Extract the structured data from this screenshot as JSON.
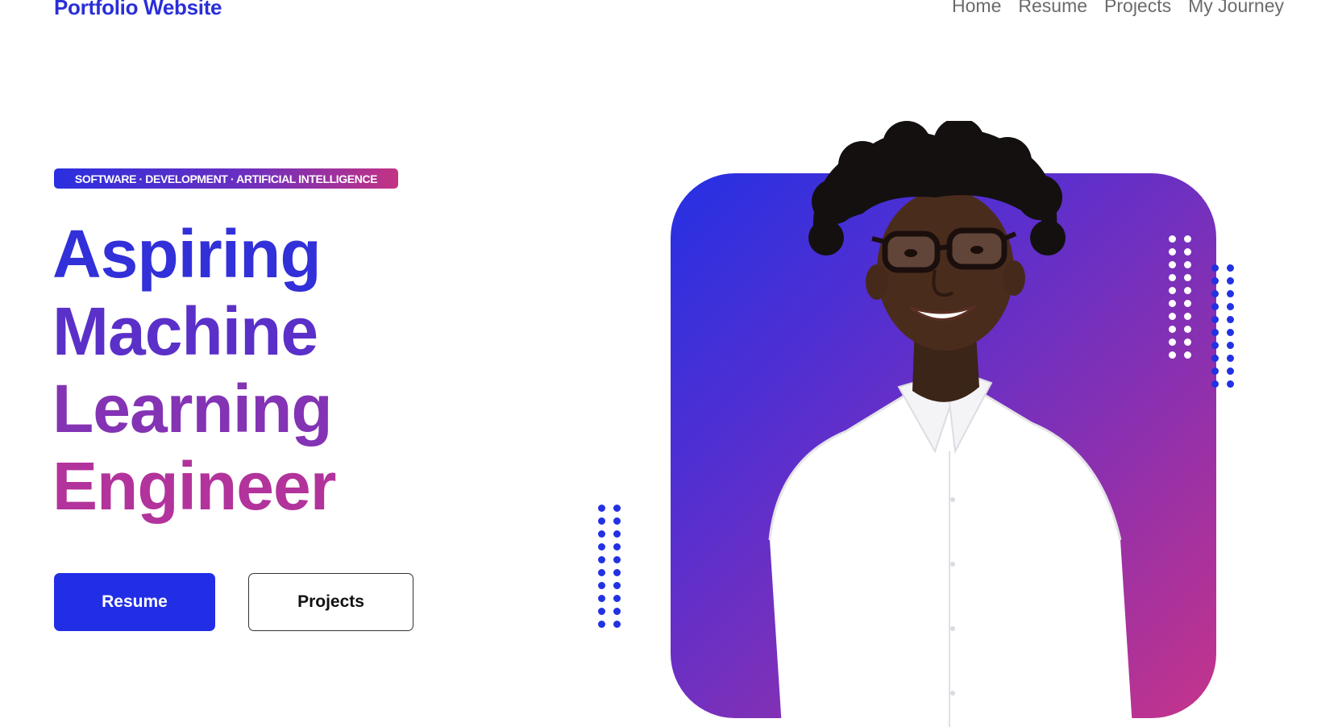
{
  "header": {
    "brand": "Portfolio Website",
    "nav": [
      "Home",
      "Resume",
      "Projects",
      "My Journey"
    ]
  },
  "hero": {
    "tagline": "SOFTWARE · DEVELOPMENT · ARTIFICIAL INTELLIGENCE",
    "headline": [
      "Aspiring",
      "Machine",
      "Learning",
      "Engineer"
    ],
    "primary_button": "Resume",
    "secondary_button": "Projects"
  },
  "colors": {
    "brand": "#2a2fd8",
    "primary_button": "#222ee6",
    "gradient_start": "#2530e3",
    "gradient_end": "#c5348a",
    "nav_text": "#6b6b6b"
  },
  "icons": [
    "portrait-photo",
    "dot-pattern"
  ]
}
